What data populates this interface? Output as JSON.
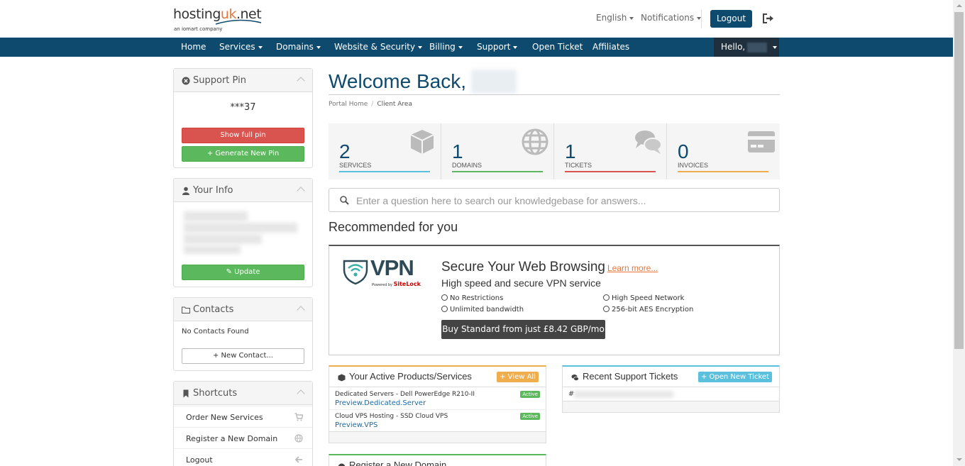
{
  "header": {
    "logo": {
      "main_a": "hosting",
      "main_b": "uk",
      "main_c": ".net",
      "sub": "an iomart company"
    },
    "language": "English",
    "notifications": "Notifications",
    "logout": "Logout"
  },
  "nav": {
    "items": [
      "Home",
      "Services",
      "Domains",
      "Website & Security",
      "Billing",
      "Support",
      "Open Ticket",
      "Affiliates"
    ],
    "hello": "Hello,"
  },
  "sidebar": {
    "support_pin": {
      "title": "Support Pin",
      "pin": "***37",
      "show_btn": "Show full pin",
      "generate_btn": "+ Generate New Pin"
    },
    "your_info": {
      "title": "Your Info",
      "update_btn": "Update"
    },
    "contacts": {
      "title": "Contacts",
      "empty": "No Contacts Found",
      "new_btn": "+ New Contact..."
    },
    "shortcuts": {
      "title": "Shortcuts",
      "items": [
        "Order New Services",
        "Register a New Domain",
        "Logout"
      ]
    }
  },
  "main": {
    "welcome": "Welcome Back,",
    "breadcrumb": [
      "Portal Home",
      "Client Area"
    ],
    "tiles": [
      {
        "count": "2",
        "label": "Services",
        "color": "#5bc0de"
      },
      {
        "count": "1",
        "label": "Domains",
        "color": "#5cb85c"
      },
      {
        "count": "1",
        "label": "Tickets",
        "color": "#d9534f"
      },
      {
        "count": "0",
        "label": "Invoices",
        "color": "#f0ad4e"
      }
    ],
    "kb_placeholder": "Enter a question here to search our knowledgebase for answers...",
    "recommended_title": "Recommended for you",
    "vpn": {
      "logo_text": "VPN",
      "logo_powered": "Powered by",
      "logo_brand": "SiteLock",
      "heading": "Secure Your Web Browsing",
      "learn_more": "Learn more...",
      "subheading": "High speed and secure VPN service",
      "features": [
        "No Restrictions",
        "High Speed Network",
        "Unlimited bandwidth",
        "256-bit AES Encryption"
      ],
      "buy_btn": "Buy Standard from just £8.42 GBP/mo"
    },
    "products": {
      "title": "Your Active Products/Services",
      "view_all": "+ View All",
      "items": [
        {
          "name": "Dedicated Servers - Dell PowerEdge R210-II",
          "domain": "Preview.Dedicated.Server",
          "status": "Active"
        },
        {
          "name": "Cloud VPS Hosting - SSD Cloud VPS",
          "domain": "Preview.VPS",
          "status": "Active"
        }
      ]
    },
    "tickets": {
      "title": "Recent Support Tickets",
      "open_new": "+ Open New Ticket",
      "row_prefix": "#"
    },
    "register_domain": {
      "title": "Register a New Domain"
    }
  }
}
